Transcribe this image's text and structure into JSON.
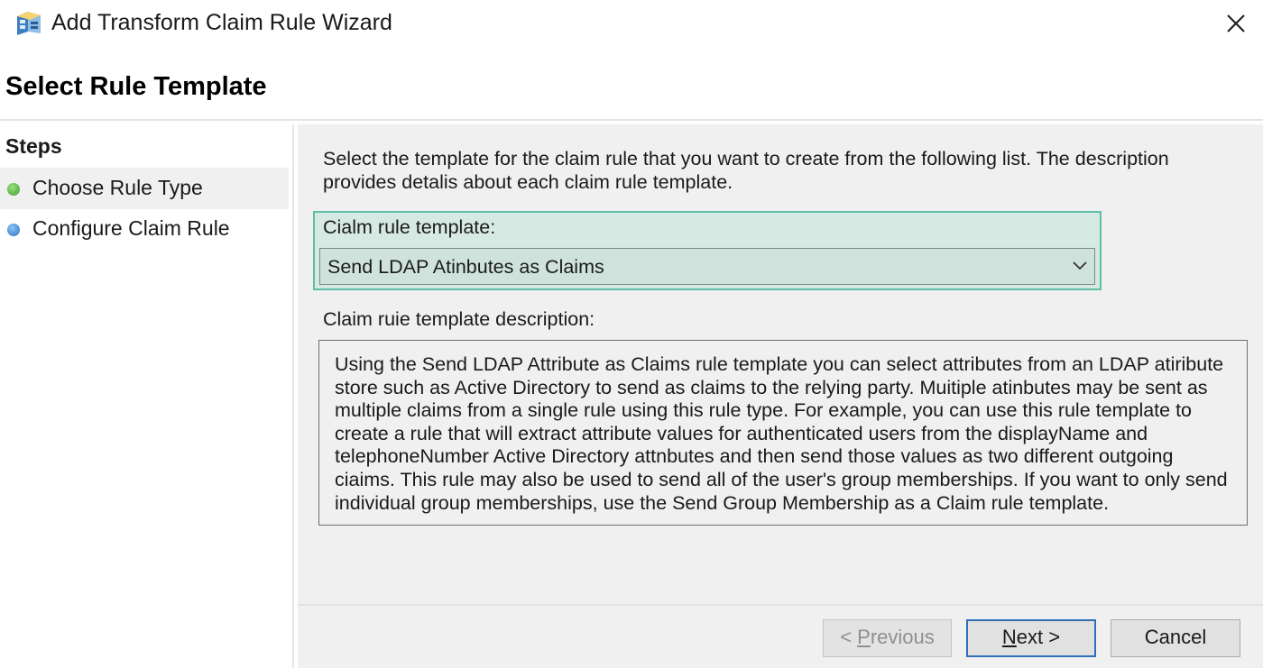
{
  "window": {
    "title": "Add Transform Claim Rule Wizard",
    "icon": "adfs-wizard-icon",
    "close_icon": "close-icon"
  },
  "header": {
    "title": "Select Rule Template"
  },
  "sidebar": {
    "heading": "Steps",
    "items": [
      {
        "label": "Choose Rule Type",
        "status_color": "#4caf3c",
        "active": true
      },
      {
        "label": "Configure Claim Rule",
        "status_color": "#2f7fd0",
        "active": false
      }
    ]
  },
  "main": {
    "intro": "Select the template for the claim rule that you want to create from the following list. The description provides detalis about each claim rule template.",
    "template_label": "Cialm rule template:",
    "template_value": "Send LDAP Atinbutes as Claims",
    "description_label": "Claim ruie template description:",
    "description": "Using the Send LDAP Attribute as Claims rule template you can select attributes from an LDAP atiribute store such as Active Directory to send as claims to the relying party. Muitiple atinbutes may be sent as multiple claims from a single rule using this rule type. For example, you can use this rule template to create a rule that will extract attribute values for authenticated users from the displayName and telephoneNumber Active Directory attnbutes and then send those values as two different outgoing ciaims. This rule may also be used to send all of the user's group memberships. If you want to only send individual group memberships, use the Send Group Membership as a Claim rule template."
  },
  "footer": {
    "previous": {
      "prefix": "< ",
      "mnemonic": "P",
      "rest": "revious",
      "enabled": false
    },
    "next": {
      "mnemonic": "N",
      "rest": "ext >",
      "enabled": true
    },
    "cancel": {
      "label": "Cancel",
      "enabled": true
    }
  },
  "colors": {
    "accent_border": "#5fbfa6",
    "accent_fill": "#d7e9e3",
    "default_button_border": "#2e6fb7"
  }
}
